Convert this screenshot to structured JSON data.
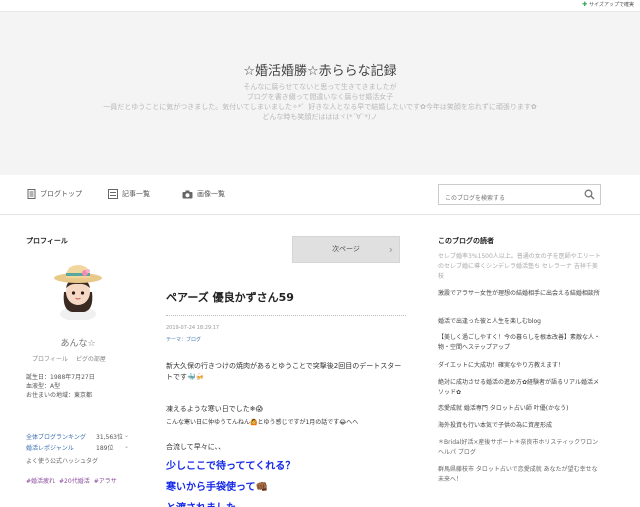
{
  "topbar": {
    "size_up": "サイズアップで確実"
  },
  "header": {
    "title": "☆婚活婚勝☆赤ららな記録",
    "desc": [
      "そんなに腐らせてないと思って生きてきましたが",
      "ブログを書き綴って間違いなく腐らせ婚活女子",
      "一員だとゆうことに気がつきました。気付いてしまいました✧*゜好きな人となる早で結婚したいです✿今年は笑顔を忘れずに頑張ります✿",
      "どんな時も笑顔だはははヾ(*´∀`*)ノ"
    ]
  },
  "nav": {
    "items": [
      "ブログトップ",
      "記事一覧",
      "画像一覧"
    ],
    "search_placeholder": "このブログを検索する"
  },
  "profile": {
    "title": "プロフィール",
    "nickname": "あんな☆",
    "links": [
      "プロフィール",
      "ピグの部屋"
    ],
    "info": [
      "誕生日：1988年7月27日",
      "血液型：A型",
      "お住まいの地域：東京都"
    ],
    "ranks": [
      {
        "label": "全体ブログランキング",
        "value": "31,563位"
      },
      {
        "label": "婚活レポジャンル",
        "value": "189位"
      }
    ],
    "hashtag_title": "よく使う公式ハッシュタグ",
    "hashtags": [
      "#婚活疲れ",
      "#20代婚活",
      "#アラサ"
    ]
  },
  "post": {
    "next": "次ページ",
    "title": "ペアーズ 優良かずさん59",
    "date": "2019-07-24 18:29:17",
    "theme": "テーマ：ブログ",
    "body1": "新大久保の行きつけの焼肉があるとゆうことで突撃後2回目のデートスタートです🐳🍻",
    "body2": "凍えるような寒い日でした❄😱",
    "body3": "こんな寒い日に仲ゆうてんねん🙆とゆう感じですが1月の話です😂へへ",
    "body4": "合流して早々に、、",
    "blue1": "少しここで待っててくれる？",
    "blue2": "寒いから手袋使って👊🏾",
    "blue3": "と渡されました"
  },
  "readers": {
    "title": "このブログの読者",
    "items": [
      "セレブ婚率3%1500人以上。普通の女の子を医師やエリートのセレブ婚に導くシンデレラ婚活塾ち セレラーナ 吉祥千美枝",
      "激震でアラサー女性が理想の結婚相手に出会える結婚相談所",
      "婚活で出逢った彼と人生を楽しむblog",
      "【美しく過ごしやすく！今の暮らしを根本改善】素敵な人・物・空間へステップアップ",
      "ダイエットに大成功！確実なやり方教えます！",
      "絶対に成功させる婚活の進め方✿経験者が語るリアル婚活メソッド✿",
      "恋愛成就 婚活専門 タロット占い師 叶優(かなう)",
      "海外投資も行い本気で子供の為に資産形成",
      "＊Bridal好活×産後サポート＊奈良市ホリスティックワロンヘルパ ブログ",
      "群馬県藤枝市 タロット占いで恋愛成就 あなたが望む幸せな未来へ！"
    ]
  }
}
